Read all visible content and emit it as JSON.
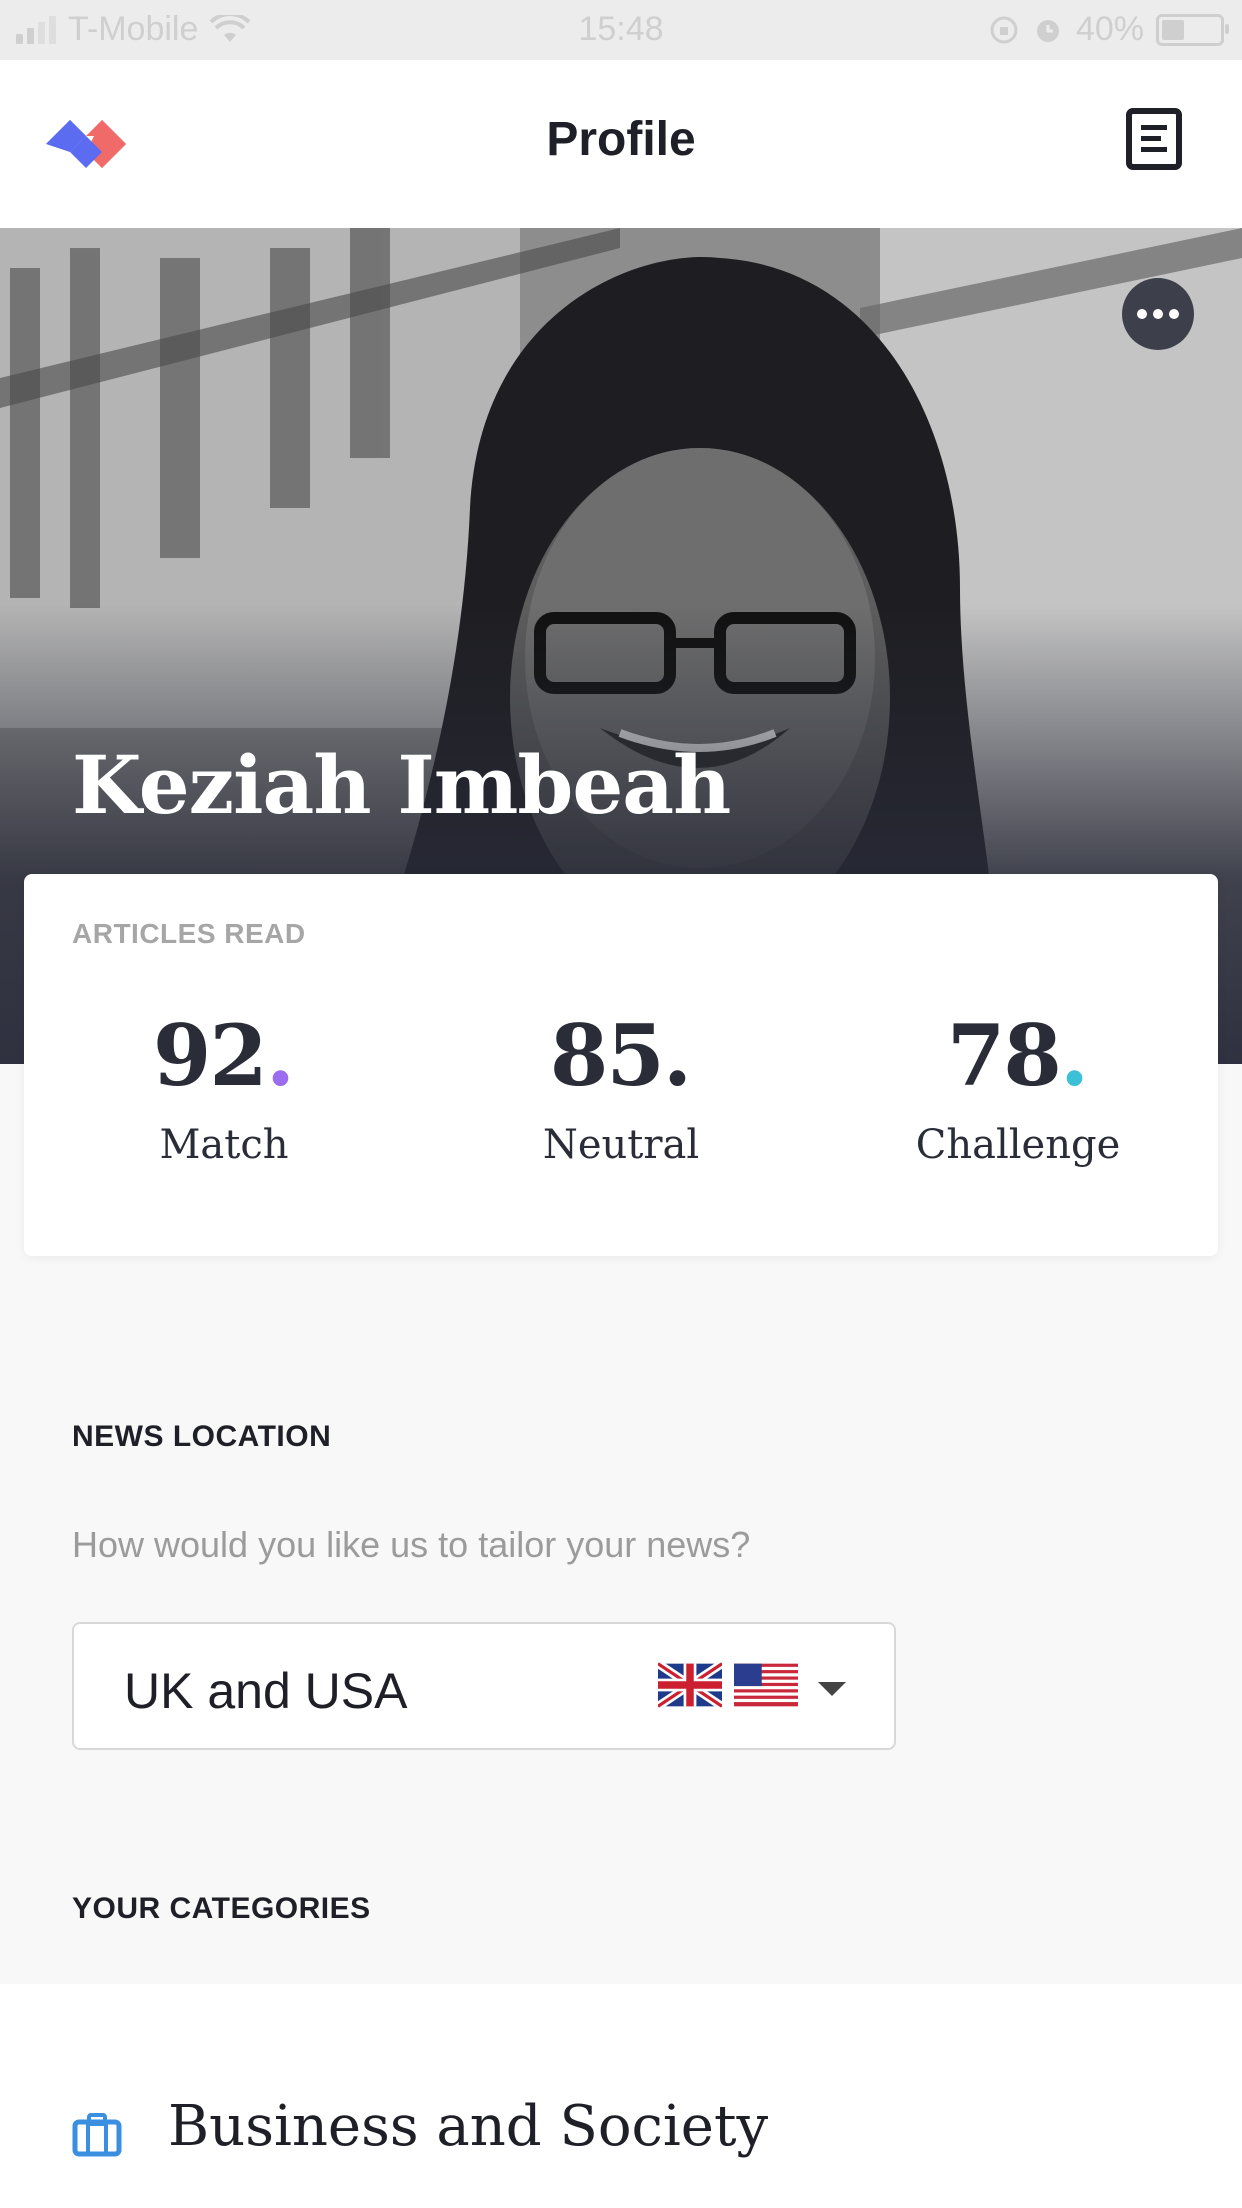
{
  "status_bar": {
    "carrier": "T-Mobile",
    "time": "15:48",
    "battery": "40%",
    "battery_level": 0.4
  },
  "header": {
    "title": "Profile",
    "logo_icon": "app-logo-icon",
    "right_icon": "articles-list-icon"
  },
  "profile": {
    "name": "Keziah Imbeah",
    "more_icon": "more-options-icon"
  },
  "stats": {
    "label": "ARTICLES READ",
    "items": [
      {
        "value": "92",
        "dot": ".",
        "label": "Match",
        "dot_color": "#9b6cf0"
      },
      {
        "value": "85",
        "dot": ".",
        "label": "Neutral",
        "dot_color": "#2a2c38"
      },
      {
        "value": "78",
        "dot": ".",
        "label": "Challenge",
        "dot_color": "#3cc0d6"
      }
    ]
  },
  "news_location": {
    "title": "NEWS LOCATION",
    "question": "How would you like us to tailor your news?",
    "selected": "UK and USA",
    "flags": [
      "uk-flag-icon",
      "usa-flag-icon"
    ]
  },
  "categories": {
    "title": "YOUR CATEGORIES",
    "items": [
      {
        "label": "Business and Society",
        "icon": "briefcase-icon",
        "icon_color": "#3a8fe0"
      }
    ]
  },
  "colors": {
    "logo_blue": "#5b6cf0",
    "logo_red": "#f06a6a",
    "accent_purple": "#9b6cf0",
    "accent_teal": "#3cc0d6"
  }
}
